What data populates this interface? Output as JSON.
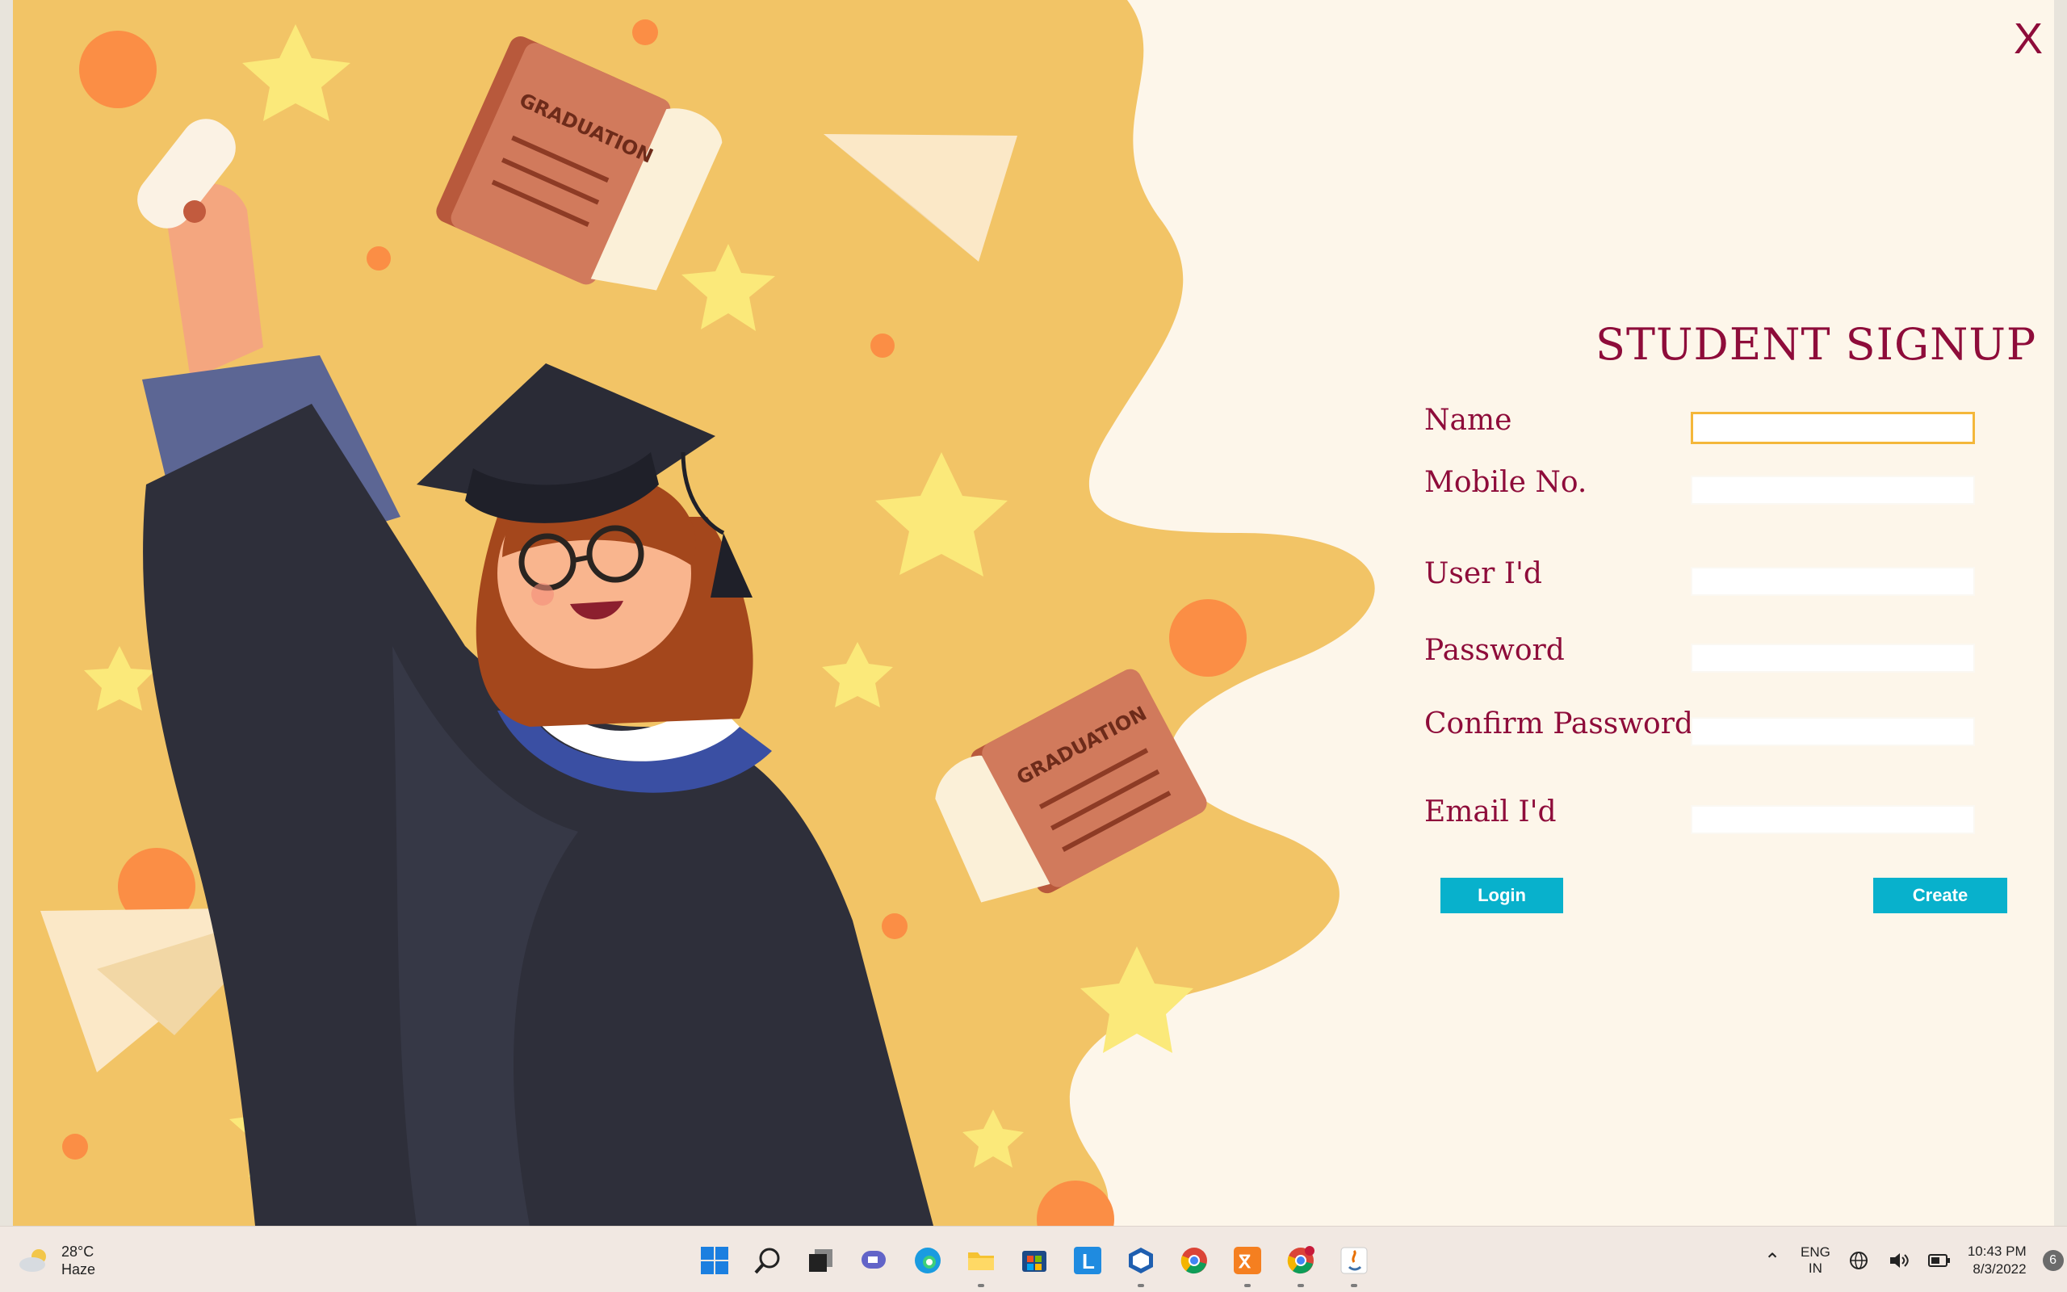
{
  "window": {
    "close_label": "X",
    "title": "STUDENT SIGNUP"
  },
  "form": {
    "fields": [
      {
        "label": "Name",
        "value": ""
      },
      {
        "label": "Mobile No.",
        "value": ""
      },
      {
        "label": "User I'd",
        "value": ""
      },
      {
        "label": "Password",
        "value": ""
      },
      {
        "label": "Confirm Password",
        "value": ""
      },
      {
        "label": "Email I'd",
        "value": ""
      }
    ],
    "login_label": "Login",
    "create_label": "Create"
  },
  "illustration": {
    "book_text": "GRADUATION"
  },
  "taskbar": {
    "weather": {
      "temp": "28°C",
      "condition": "Haze",
      "icon": "haze-cloud-icon"
    },
    "apps": [
      "start-icon",
      "search-icon",
      "task-view-icon",
      "teams-chat-icon",
      "edge-icon",
      "file-explorer-icon",
      "store-icon",
      "launcher-l-icon",
      "virtualbox-icon",
      "chrome-icon",
      "xampp-icon",
      "chrome-profile-icon",
      "java-icon"
    ],
    "tray": {
      "lang_top": "ENG",
      "lang_bottom": "IN",
      "time": "10:43 PM",
      "date": "8/3/2022",
      "notifications": "6"
    }
  },
  "colors": {
    "accent_text": "#8e0c3a",
    "button": "#08b1cc",
    "background_left": "#f2c466",
    "background_right": "#fdf6ea"
  }
}
